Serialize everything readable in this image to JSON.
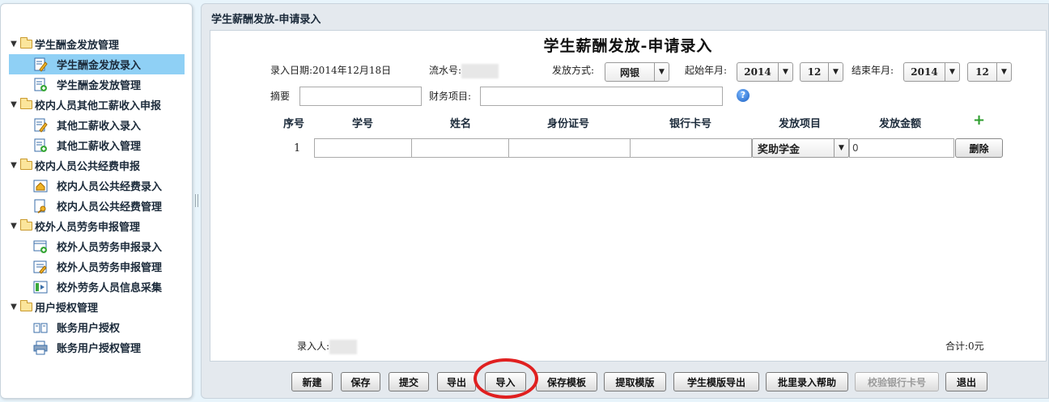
{
  "sidebar": {
    "groups": [
      {
        "label": "学生酬金发放管理",
        "items": [
          {
            "label": "学生酬金发放录入",
            "icon": "edit-doc-icon",
            "active": true
          },
          {
            "label": "学生酬金发放管理",
            "icon": "manage-doc-icon"
          }
        ]
      },
      {
        "label": "校内人员其他工薪收入申报",
        "items": [
          {
            "label": "其他工薪收入录入",
            "icon": "edit-doc-icon"
          },
          {
            "label": "其他工薪收入管理",
            "icon": "manage-doc-icon"
          }
        ]
      },
      {
        "label": "校内人员公共经费申报",
        "items": [
          {
            "label": "校内人员公共经费录入",
            "icon": "home-doc-icon"
          },
          {
            "label": "校内人员公共经费管理",
            "icon": "key-doc-icon"
          }
        ]
      },
      {
        "label": "校外人员劳务申报管理",
        "items": [
          {
            "label": "校外人员劳务申报录入",
            "icon": "add-doc-icon"
          },
          {
            "label": "校外人员劳务申报管理",
            "icon": "list-doc-icon"
          },
          {
            "label": "校外劳务人员信息采集",
            "icon": "collect-icon"
          }
        ]
      },
      {
        "label": "用户授权管理",
        "items": [
          {
            "label": "账务用户授权",
            "icon": "book-icon"
          },
          {
            "label": "账务用户授权管理",
            "icon": "printer-icon"
          }
        ]
      }
    ]
  },
  "panel": {
    "title": "学生薪酬发放-申请录入"
  },
  "form": {
    "heading": "学生薪酬发放-申请录入",
    "entry_date": "录入日期:2014年12月18日",
    "serial_label": "流水号:",
    "pay_method_label": "发放方式:",
    "pay_method_value": "网银",
    "start_label": "起始年月:",
    "start_year": "2014",
    "start_month": "12",
    "end_label": "结束年月:",
    "end_year": "2014",
    "end_month": "12",
    "summary_label": "摘要",
    "summary_value": "",
    "finance_label": "财务项目:",
    "finance_value": "",
    "help_glyph": "?",
    "add_glyph": "+",
    "columns": [
      "序号",
      "学号",
      "姓名",
      "身份证号",
      "银行卡号",
      "发放项目",
      "发放金额"
    ],
    "rows": [
      {
        "index": "1",
        "student_no": "",
        "name": "",
        "id_no": "",
        "bank_card": "",
        "item": "奖助学金",
        "amount": "0",
        "delete_label": "删除"
      }
    ],
    "recorder_label": "录入人:",
    "total": "合计:0元"
  },
  "toolbar": {
    "buttons": [
      {
        "label": "新建",
        "enabled": true
      },
      {
        "label": "保存",
        "enabled": true
      },
      {
        "label": "提交",
        "enabled": true
      },
      {
        "label": "导出",
        "enabled": true
      },
      {
        "label": "导入",
        "enabled": true,
        "highlighted": true
      },
      {
        "label": "保存模板",
        "enabled": true
      },
      {
        "label": "提取模版",
        "enabled": true
      },
      {
        "label": "学生模版导出",
        "enabled": true
      },
      {
        "label": "批里录入帮助",
        "enabled": true
      },
      {
        "label": "校验银行卡号",
        "enabled": false
      },
      {
        "label": "退出",
        "enabled": true
      }
    ]
  },
  "colors": {
    "highlight_circle": "#e02020",
    "active_item": "#8fd0f5",
    "help_icon": "#1b5fc2",
    "add_icon": "#2e9d2e"
  }
}
